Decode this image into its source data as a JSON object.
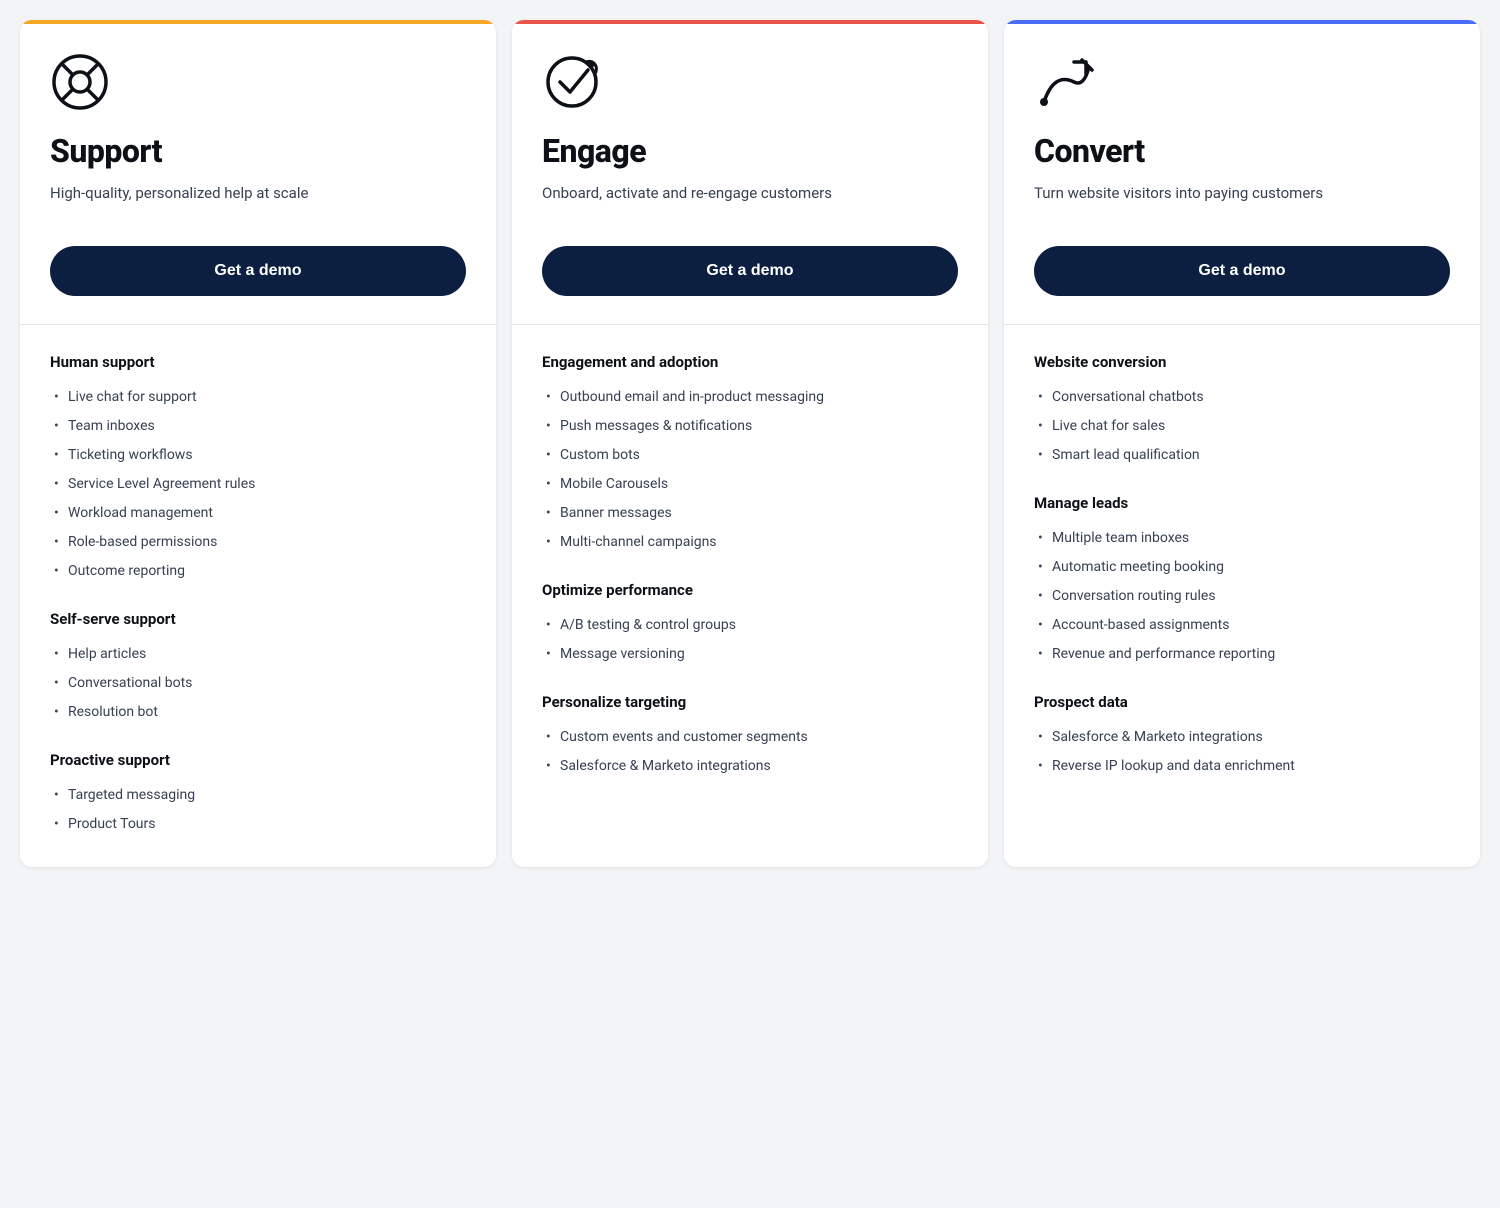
{
  "cards": [
    {
      "id": "support",
      "icon_type": "support-icon",
      "title": "Support",
      "subtitle": "High-quality, personalized help at scale",
      "button_label": "Get a demo",
      "border_color": "#f5a623",
      "sections": [
        {
          "title": "Human support",
          "items": [
            "Live chat for support",
            "Team inboxes",
            "Ticketing workflows",
            "Service Level Agreement rules",
            "Workload management",
            "Role-based permissions",
            "Outcome reporting"
          ]
        },
        {
          "title": "Self-serve support",
          "items": [
            "Help articles",
            "Conversational bots",
            "Resolution bot"
          ]
        },
        {
          "title": "Proactive support",
          "items": [
            "Targeted messaging",
            "Product Tours"
          ]
        }
      ]
    },
    {
      "id": "engage",
      "icon_type": "engage-icon",
      "title": "Engage",
      "subtitle": "Onboard, activate and re-engage customers",
      "button_label": "Get a demo",
      "border_color": "#e8534a",
      "sections": [
        {
          "title": "Engagement and adoption",
          "items": [
            "Outbound email and in-product messaging",
            "Push messages & notifications",
            "Custom bots",
            "Mobile Carousels",
            "Banner messages",
            "Multi-channel campaigns"
          ]
        },
        {
          "title": "Optimize performance",
          "items": [
            "A/B testing & control groups",
            "Message versioning"
          ]
        },
        {
          "title": "Personalize targeting",
          "items": [
            "Custom events and customer segments",
            "Salesforce & Marketo integrations"
          ]
        }
      ]
    },
    {
      "id": "convert",
      "icon_type": "convert-icon",
      "title": "Convert",
      "subtitle": "Turn website visitors into paying customers",
      "button_label": "Get a demo",
      "border_color": "#4a6cf7",
      "sections": [
        {
          "title": "Website conversion",
          "items": [
            "Conversational chatbots",
            "Live chat for sales",
            "Smart lead qualification"
          ]
        },
        {
          "title": "Manage leads",
          "items": [
            "Multiple team inboxes",
            "Automatic meeting booking",
            "Conversation routing rules",
            "Account-based assignments",
            "Revenue and performance reporting"
          ]
        },
        {
          "title": "Prospect data",
          "items": [
            "Salesforce & Marketo integrations",
            "Reverse IP lookup and data enrichment"
          ]
        }
      ]
    }
  ]
}
